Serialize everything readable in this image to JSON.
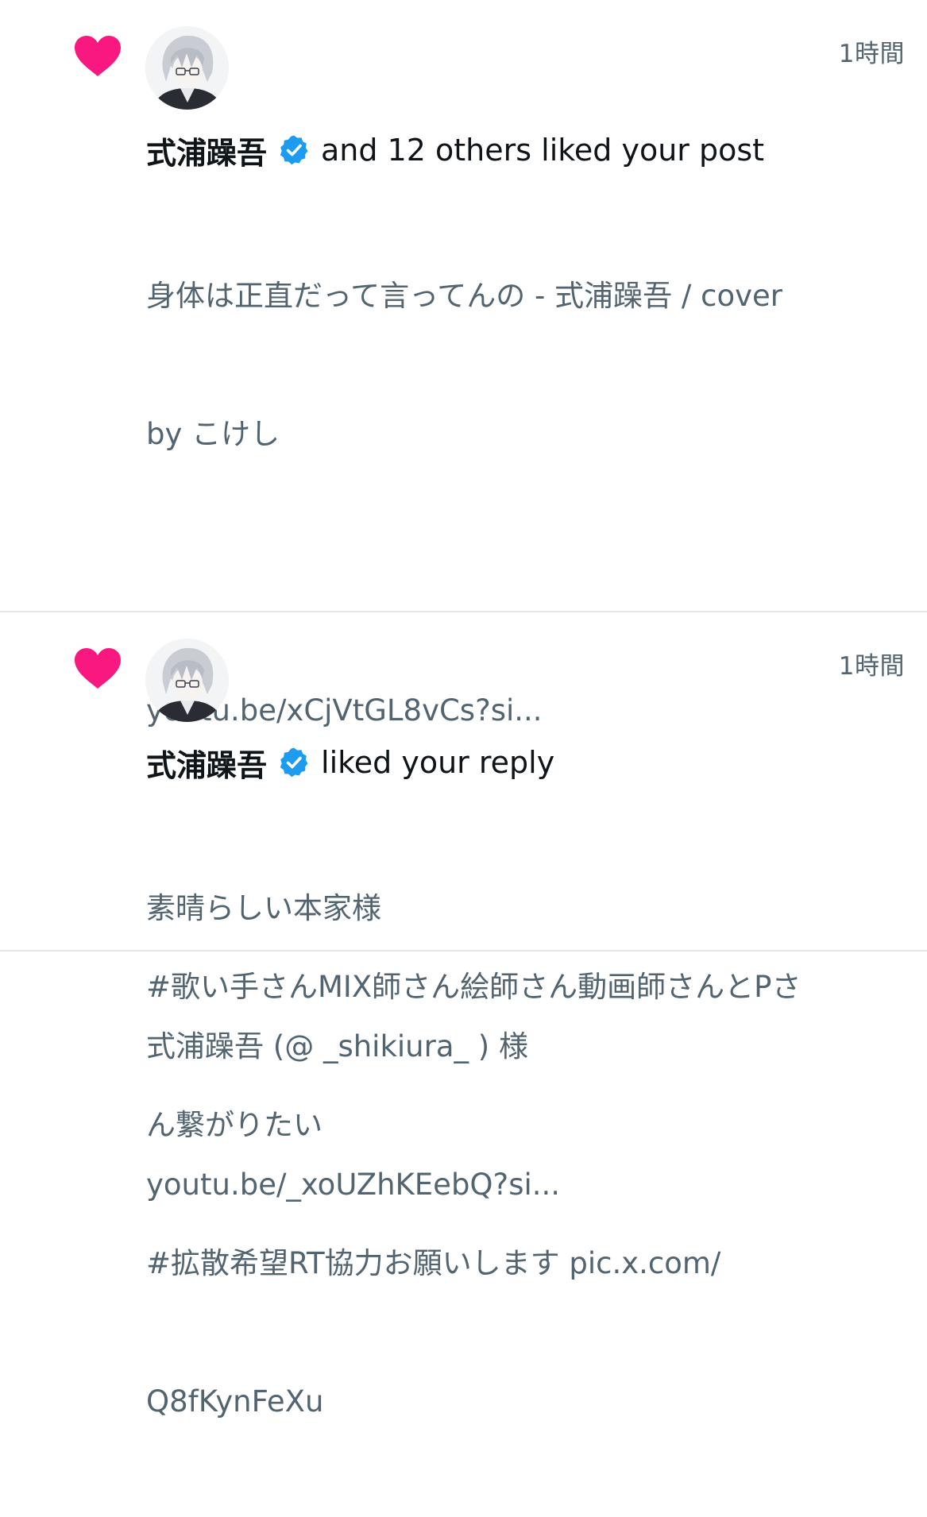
{
  "notifications": [
    {
      "icon": "heart-icon",
      "time": "1時間",
      "actor": "式浦躁吾",
      "verified": true,
      "action": "and 12 others liked your post",
      "text_lines": [
        "身体は正直だって言ってんの - 式浦躁吾 / cover",
        "by こけし",
        "",
        "youtu.be/xCjVtGL8vCs?si...",
        "",
        "#歌い手さんMIX師さん絵師さん動画師さんとPさ",
        "ん繋がりたい",
        "#拡散希望RT協力お願いします pic.x.com/",
        "Q8fKynFeXu"
      ]
    },
    {
      "icon": "heart-icon",
      "time": "1時間",
      "actor": "式浦躁吾",
      "verified": true,
      "action": "liked your reply",
      "text_lines": [
        "素晴らしい本家様",
        "式浦躁吾 (@ _shikiura_ ) 様",
        "youtu.be/_xoUZhKEebQ?si..."
      ]
    }
  ],
  "colors": {
    "heart": "#f91880",
    "verified": "#1d9bf0",
    "secondary_text": "#536471",
    "divider": "#e4e6e8"
  }
}
